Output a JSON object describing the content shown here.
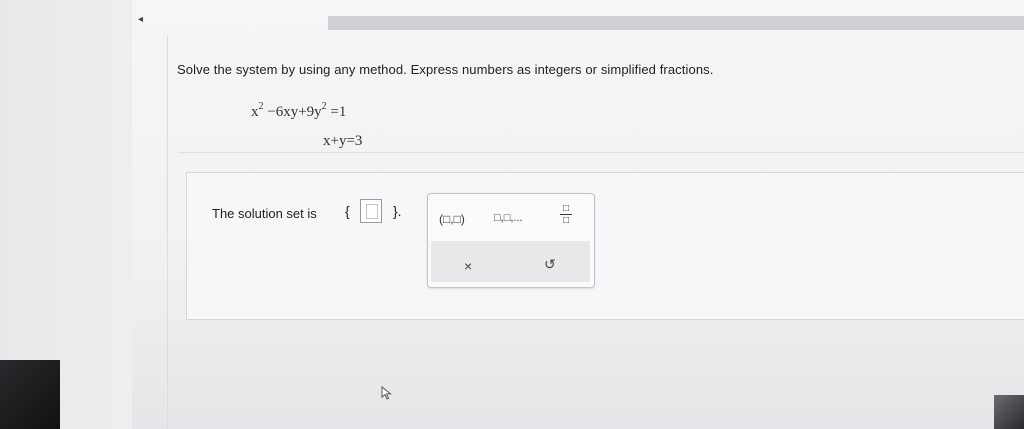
{
  "question": {
    "prompt": "Solve the system by using any method. Express numbers as integers or simplified fractions.",
    "equations": [
      {
        "x": "x",
        "x_exp": "2",
        "mid": " −6xy+9y",
        "y_exp": "2",
        "rhs": " =1"
      },
      {
        "text": "x+y=3"
      }
    ]
  },
  "answer": {
    "label": "The solution set is",
    "open_brace": "{",
    "close_brace": "}.",
    "value": ""
  },
  "palette": {
    "ordered_pair": "(□,□)",
    "list": "□,□,...",
    "fraction_num": "□",
    "fraction_den": "□",
    "clear": "×",
    "undo": "↺"
  },
  "nav": {
    "back": "◂"
  }
}
